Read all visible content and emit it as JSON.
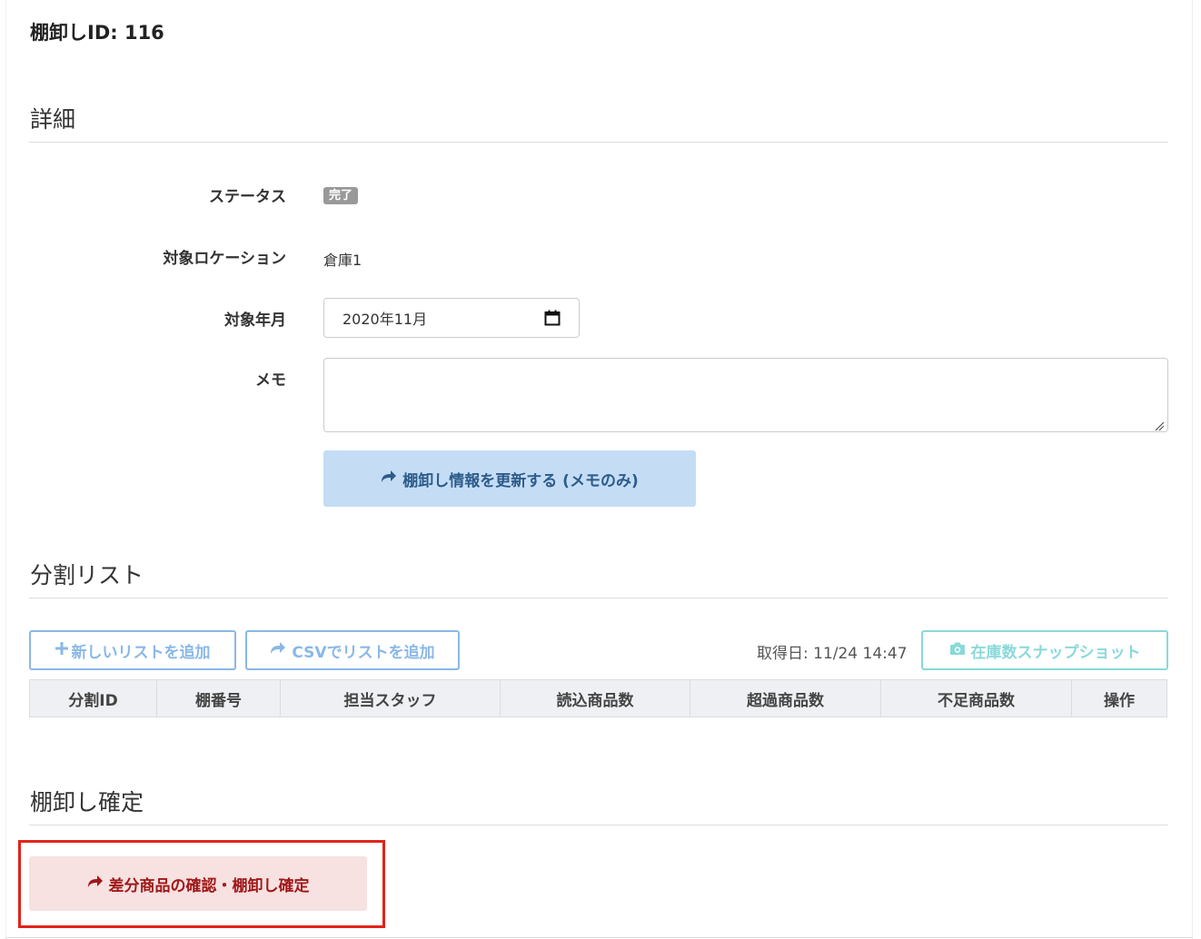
{
  "page": {
    "title": "棚卸しID: 116"
  },
  "details": {
    "heading": "詳細",
    "status_label": "ステータス",
    "status_value": "完了",
    "location_label": "対象ロケーション",
    "location_value": "倉庫1",
    "month_label": "対象年月",
    "month_value": "2020年11月",
    "memo_label": "メモ",
    "memo_value": "",
    "update_button": "棚卸し情報を更新する (メモのみ)"
  },
  "split_list": {
    "heading": "分割リスト",
    "add_button": "新しいリストを追加",
    "csv_button": "CSVでリストを追加",
    "fetch_date": "取得日: 11/24 14:47",
    "snapshot_button": "在庫数スナップショット",
    "columns": [
      "分割ID",
      "棚番号",
      "担当スタッフ",
      "読込商品数",
      "超過商品数",
      "不足商品数",
      "操作"
    ]
  },
  "confirm": {
    "heading": "棚卸し確定",
    "confirm_button": "差分商品の確認・棚卸し確定"
  },
  "colors": {
    "update_bg": "#c4ddf5",
    "confirm_bg": "#f7e1e1",
    "confirm_text": "#a01818",
    "highlight_box": "#e2231a"
  }
}
